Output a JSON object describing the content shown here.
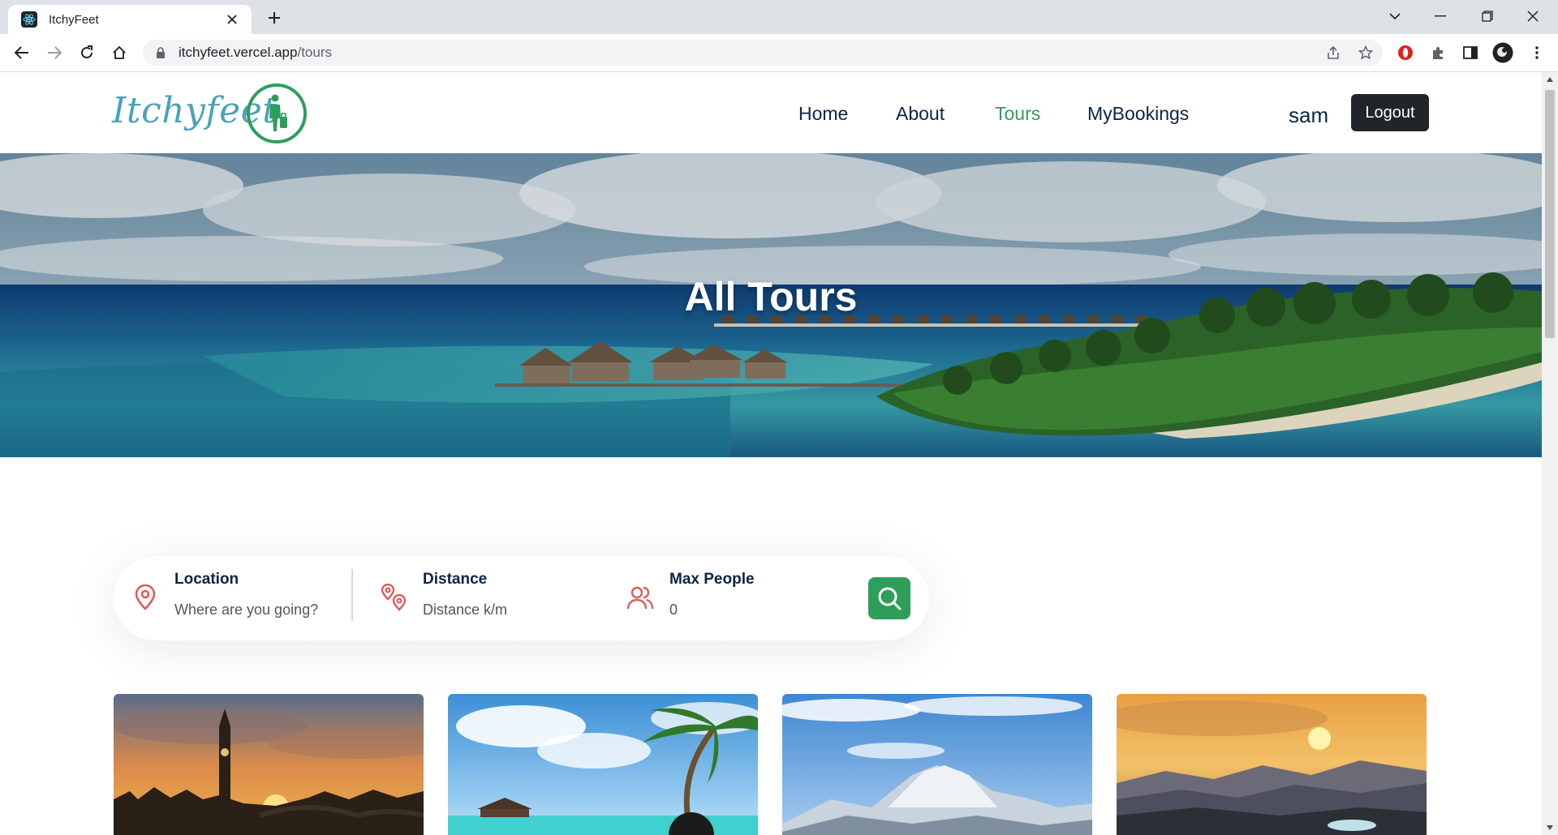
{
  "browser": {
    "tab_title": "ItchyFeet",
    "url_host": "itchyfeet.vercel.app",
    "url_path": "/tours"
  },
  "header": {
    "logo_text": "Itchyfeet",
    "nav": [
      {
        "label": "Home",
        "active": false
      },
      {
        "label": "About",
        "active": false
      },
      {
        "label": "Tours",
        "active": true
      },
      {
        "label": "MyBookings",
        "active": false
      }
    ],
    "username": "sam",
    "logout_label": "Logout"
  },
  "hero": {
    "title": "All Tours"
  },
  "search": {
    "location": {
      "label": "Location",
      "placeholder": "Where are you going?"
    },
    "distance": {
      "label": "Distance",
      "placeholder": "Distance k/m"
    },
    "max_people": {
      "label": "Max People",
      "placeholder": "0"
    }
  },
  "cards": [
    {
      "scene": "city-sunset"
    },
    {
      "scene": "tropical-beach"
    },
    {
      "scene": "snowy-mountain"
    },
    {
      "scene": "hill-sunset"
    }
  ],
  "colors": {
    "accent_green": "#2e9e5b",
    "nav_text": "#0b2545",
    "icon_red": "#e05a5a",
    "logout_bg": "#212529"
  }
}
